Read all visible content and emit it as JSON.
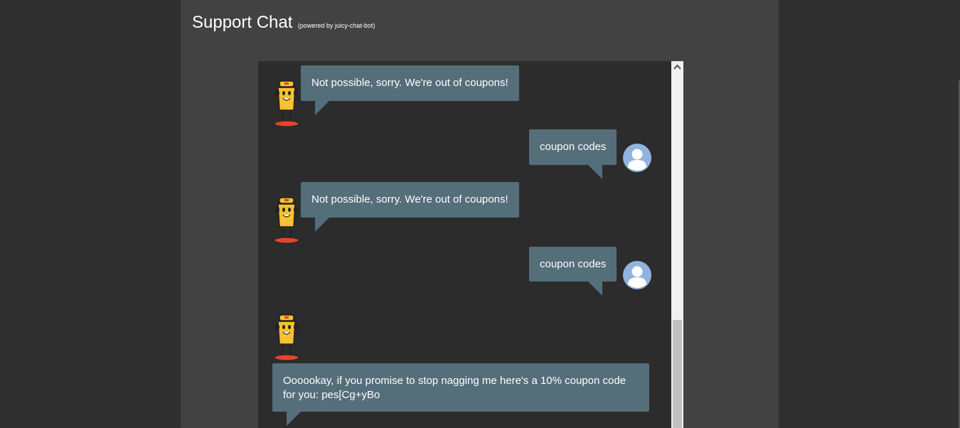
{
  "header": {
    "title": "Support Chat",
    "powered_by": "(powered by juicy-chat-bot)"
  },
  "messages": [
    {
      "sender": "bot",
      "text": "Not possible, sorry. We're out of coupons!"
    },
    {
      "sender": "user",
      "text": "coupon codes"
    },
    {
      "sender": "bot",
      "text": "Not possible, sorry. We're out of coupons!"
    },
    {
      "sender": "user",
      "text": "coupon codes"
    },
    {
      "sender": "bot",
      "text": "Oooookay, if you promise to stop nagging me here's a 10% coupon code for you: pes[Cg+yBo"
    }
  ],
  "colors": {
    "background": "#303030",
    "panel": "#424242",
    "chat_window": "#2c2c2c",
    "bubble": "#546e7a",
    "user_avatar": "#90b4de",
    "bot_body": "#f6c132"
  },
  "icons": {
    "bot_avatar": "juicy-bot-mascot-icon",
    "user_avatar": "user-silhouette-icon",
    "scroll_up": "triangle-up-icon"
  }
}
